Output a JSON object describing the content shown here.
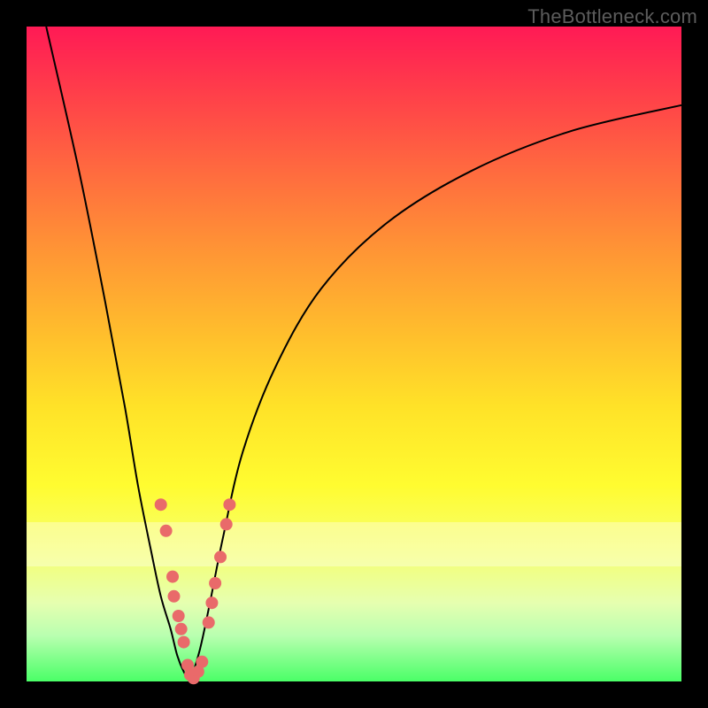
{
  "watermark": "TheBottleneck.com",
  "colors": {
    "frame": "#000000",
    "curve": "#000000",
    "dots": "#e96a6a"
  },
  "chart_data": {
    "type": "line",
    "title": "",
    "xlabel": "",
    "ylabel": "",
    "xlim": [
      0,
      100
    ],
    "ylim": [
      0,
      100
    ],
    "grid": false,
    "legend": false,
    "series": [
      {
        "name": "left-curve",
        "x": [
          3,
          8,
          12,
          15,
          17,
          19,
          20.5,
          22,
          23,
          24,
          25
        ],
        "y": [
          100,
          78,
          58,
          42,
          30,
          20,
          13,
          8,
          4,
          1.5,
          0
        ]
      },
      {
        "name": "right-curve",
        "x": [
          25,
          26.5,
          28,
          30,
          33,
          38,
          45,
          55,
          68,
          83,
          100
        ],
        "y": [
          0,
          5,
          12,
          22,
          35,
          48,
          60,
          70,
          78,
          84,
          88
        ]
      }
    ],
    "points": [
      {
        "name": "left-cluster",
        "x": 20.5,
        "y": 27
      },
      {
        "name": "left-cluster",
        "x": 21.3,
        "y": 23
      },
      {
        "name": "left-cluster",
        "x": 22.3,
        "y": 16
      },
      {
        "name": "left-cluster",
        "x": 22.5,
        "y": 13
      },
      {
        "name": "left-cluster",
        "x": 23.2,
        "y": 10
      },
      {
        "name": "left-cluster",
        "x": 23.6,
        "y": 8
      },
      {
        "name": "left-cluster",
        "x": 24.0,
        "y": 6
      },
      {
        "name": "bottom",
        "x": 24.6,
        "y": 2.5
      },
      {
        "name": "bottom",
        "x": 25.0,
        "y": 1.0
      },
      {
        "name": "bottom",
        "x": 25.5,
        "y": 0.5
      },
      {
        "name": "bottom",
        "x": 26.2,
        "y": 1.5
      },
      {
        "name": "bottom",
        "x": 26.8,
        "y": 3.0
      },
      {
        "name": "right-cluster",
        "x": 27.8,
        "y": 9
      },
      {
        "name": "right-cluster",
        "x": 28.3,
        "y": 12
      },
      {
        "name": "right-cluster",
        "x": 28.8,
        "y": 15
      },
      {
        "name": "right-cluster",
        "x": 29.6,
        "y": 19
      },
      {
        "name": "right-cluster",
        "x": 30.5,
        "y": 24
      },
      {
        "name": "right-cluster",
        "x": 31.0,
        "y": 27
      }
    ]
  }
}
